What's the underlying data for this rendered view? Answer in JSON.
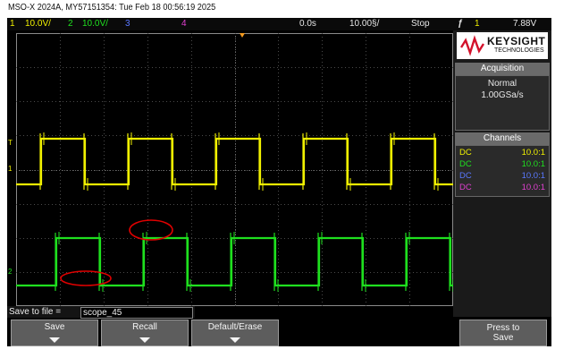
{
  "title": "MSO-X 2024A, MY57151354: Tue Feb 18 00:56:19 2025",
  "statusbar": {
    "ch1_num": "1",
    "ch1_scale": "10.0V/",
    "ch2_num": "2",
    "ch2_scale": "10.0V/",
    "ch3_num": "3",
    "ch4_num": "4",
    "time_offset": "0.0s",
    "time_scale": "10.00§/",
    "run_state": "Stop",
    "trigger_icon": "ƒ",
    "trigger_source": "1",
    "trigger_level": "7.88V"
  },
  "panel": {
    "logo_brand": "KEYSIGHT",
    "logo_sub": "TECHNOLOGIES",
    "acquisition_header": "Acquisition",
    "acquisition_mode": "Normal",
    "sample_rate": "1.00GSa/s",
    "channels_header": "Channels",
    "channels": [
      {
        "coupling": "DC",
        "probe": "10.0:1",
        "color": "#f0f000"
      },
      {
        "coupling": "DC",
        "probe": "10.0:1",
        "color": "#1fe01f"
      },
      {
        "coupling": "DC",
        "probe": "10.0:1",
        "color": "#5a78ff"
      },
      {
        "coupling": "DC",
        "probe": "10.0:1",
        "color": "#e040d0"
      }
    ]
  },
  "markers": {
    "trig_marker": "T",
    "ch1_marker": "1",
    "ch2_marker": "2"
  },
  "save": {
    "label": "Save to file =",
    "filename": "scope_45"
  },
  "softkeys": {
    "save": "Save",
    "recall": "Recall",
    "default_erase": "Default/Erase",
    "press_to_save": "Press to Save"
  },
  "colors": {
    "ch1": "#f0f000",
    "ch2": "#1fe01f",
    "ch3": "#5a78ff",
    "ch4": "#e040d0",
    "annotation": "#e00000"
  }
}
